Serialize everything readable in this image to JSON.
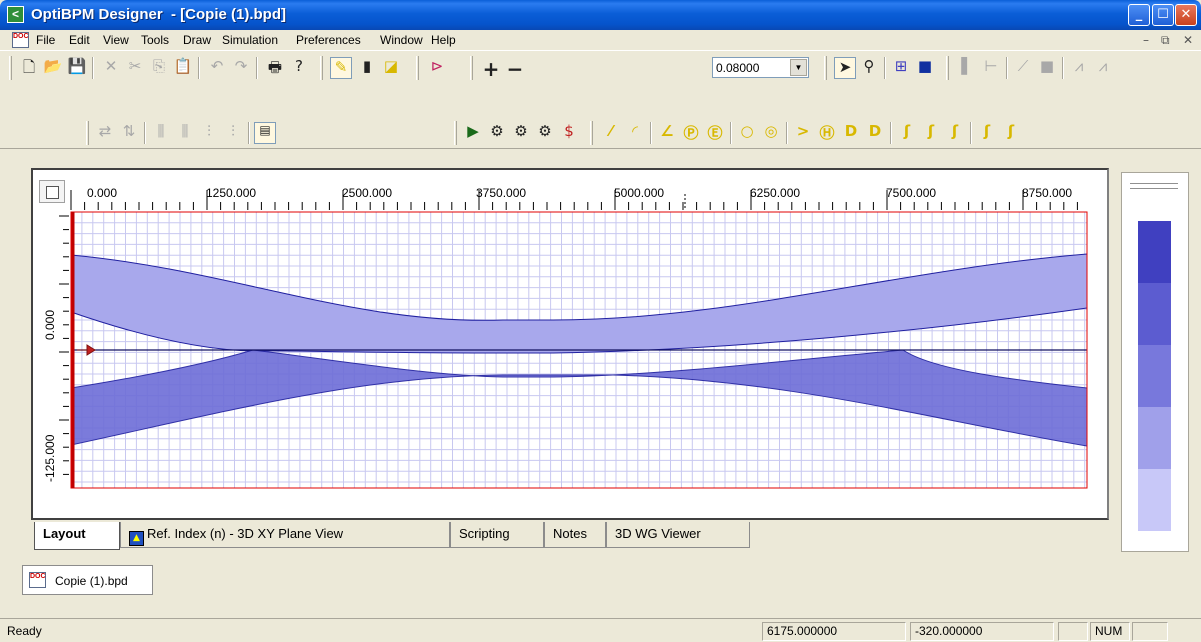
{
  "window": {
    "title": "OptiBPM Designer  - [Copie (1).bpd]",
    "app_icon": "optibpm-logo-icon",
    "minimize": "_",
    "maximize": "☐",
    "close": "✕"
  },
  "menu": {
    "doc_icon_text": "DOC",
    "items": [
      "File",
      "Edit",
      "View",
      "Tools",
      "Draw",
      "Simulation",
      "Preferences",
      "Window",
      "Help"
    ],
    "mdi_minimize": "–",
    "mdi_restore": "⧉",
    "mdi_close": "✕"
  },
  "toolbar": {
    "zoom_value": "0.08000"
  },
  "layout": {
    "x_ticks": [
      "0.000",
      "1250.000",
      "2500.000",
      "3750.000",
      "5000.000",
      "6250.000",
      "7500.000",
      "8750.000"
    ],
    "y_ticks": [
      "0.000",
      "-125.000"
    ],
    "colors": {
      "grid": "#c8c8f0",
      "waveguide_upper": "#a8a8ec",
      "waveguide_lower": "#7070d8",
      "boundary": "#e00000",
      "outline": "#2020a0"
    }
  },
  "tabs": [
    {
      "label": "Layout",
      "active": true
    },
    {
      "label": "Ref. Index (n) - 3D XY Plane View",
      "active": false
    },
    {
      "label": "Scripting",
      "active": false
    },
    {
      "label": "Notes",
      "active": false
    },
    {
      "label": "3D WG Viewer",
      "active": false
    }
  ],
  "legend": {
    "colors": [
      "#4040c0",
      "#5c5cd0",
      "#7878dc",
      "#a0a0ea",
      "#c8c8f8"
    ]
  },
  "doc_tab": {
    "label": "Copie (1).bpd",
    "icon_text": "DOC"
  },
  "status": {
    "ready": "Ready",
    "x_coord": "6175.000000",
    "y_coord": "-320.000000",
    "num": "NUM"
  }
}
